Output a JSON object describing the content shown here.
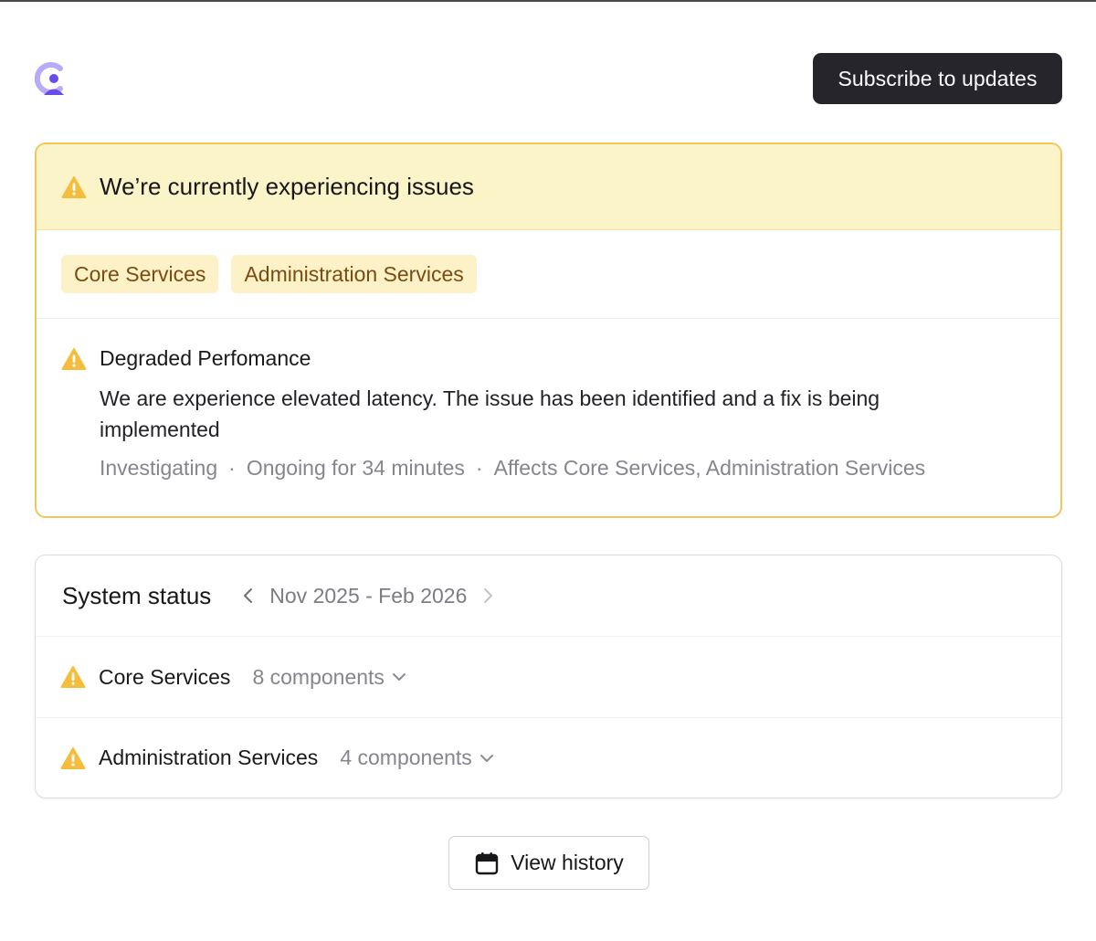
{
  "header": {
    "subscribe_label": "Subscribe to updates"
  },
  "colors": {
    "warning": "#f5bd3d",
    "banner_bg": "#fcf4c9",
    "tag_bg": "#fcf1c7",
    "tag_text": "#7a4b12",
    "brand_purple": "#6b4ce6",
    "dark_button": "#25252b"
  },
  "incident": {
    "title": "We’re currently experiencing issues",
    "tags": [
      "Core Services",
      "Administration Services"
    ],
    "update": {
      "title": "Degraded Perfomance",
      "body": "We are experience elevated latency. The issue has been identified and a fix is being implemented",
      "status": "Investigating",
      "duration": "Ongoing for 34 minutes",
      "affects": "Affects Core Services, Administration Services"
    }
  },
  "system_status": {
    "title": "System status",
    "range": "Nov 2025 - Feb 2026",
    "groups": [
      {
        "name": "Core Services",
        "components": "8 components"
      },
      {
        "name": "Administration Services",
        "components": "4 components"
      }
    ]
  },
  "history": {
    "label": "View history"
  },
  "icons": {
    "logo": "brand-logo-icon",
    "warning": "warning-triangle-icon",
    "prev": "chevron-left-icon",
    "next": "chevron-right-icon",
    "expand": "chevron-down-icon",
    "calendar": "calendar-icon"
  }
}
